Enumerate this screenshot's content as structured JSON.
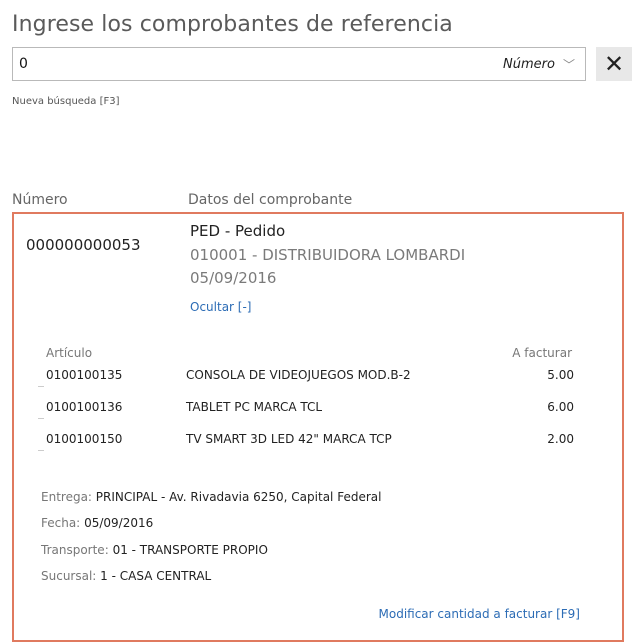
{
  "header": {
    "title": "Ingrese los comprobantes de referencia"
  },
  "search": {
    "value": "0",
    "type_label": "Número",
    "new_search_label": "Nueva búsqueda [F3]"
  },
  "columns": {
    "number": "Número",
    "data": "Datos del comprobante"
  },
  "document": {
    "number": "000000000053",
    "type": "PED - Pedido",
    "client": "010001 - DISTRIBUIDORA LOMBARDI",
    "date": "05/09/2016",
    "hide_label": "Ocultar [-]",
    "items_header": {
      "article": "Artículo",
      "to_invoice": "A facturar"
    },
    "items": [
      {
        "code": "0100100135",
        "description": "CONSOLA DE VIDEOJUEGOS MOD.B-2",
        "qty": "5.00"
      },
      {
        "code": "0100100136",
        "description": "TABLET PC  MARCA TCL",
        "qty": "6.00"
      },
      {
        "code": "0100100150",
        "description": "TV SMART 3D LED 42\" MARCA TCP",
        "qty": "2.00"
      }
    ],
    "info": {
      "delivery_label": "Entrega:",
      "delivery": "PRINCIPAL - Av. Rivadavia 6250, Capital Federal",
      "date_label": "Fecha:",
      "date": "05/09/2016",
      "transport_label": "Transporte:",
      "transport": "01 - TRANSPORTE PROPIO",
      "branch_label": "Sucursal:",
      "branch": "1 - CASA CENTRAL"
    },
    "modify_label": "Modificar cantidad a facturar [F9]"
  },
  "icons": {
    "close": "close-icon",
    "dropdown": "chevron-down-icon"
  }
}
